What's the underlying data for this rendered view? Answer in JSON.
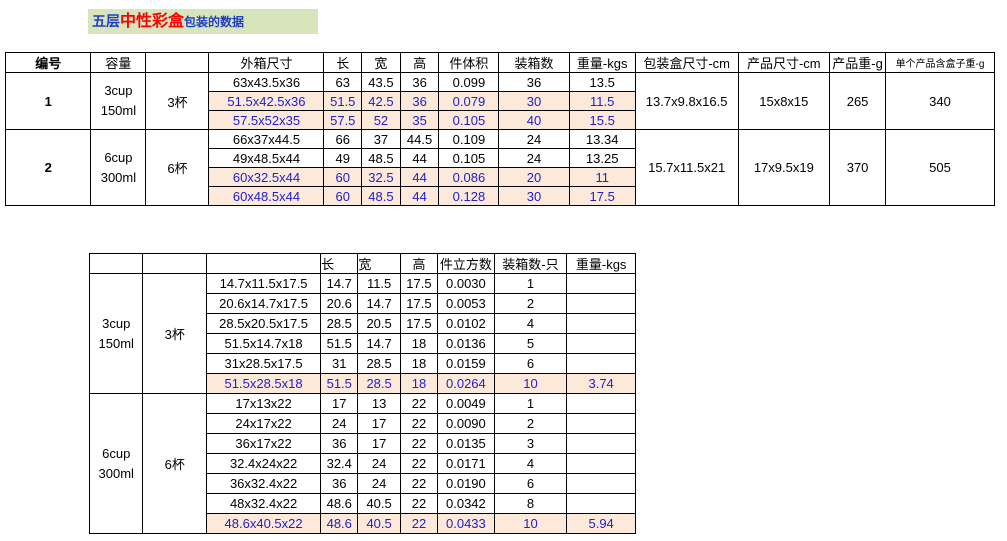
{
  "title": {
    "part1": "五层",
    "part2": "中性彩盒",
    "part3": "包装的数据"
  },
  "table1": {
    "headers": [
      "编号",
      "容量",
      "",
      "外箱尺寸",
      "长",
      "宽",
      "高",
      "件体积",
      "装箱数",
      "重量-kgs",
      "包装盒尺寸-cm",
      "产品尺寸-cm",
      "产品重-g",
      "单个产品含盒子重-g"
    ],
    "groups": [
      {
        "id": "1",
        "cap1": "3cup",
        "cap2": "150ml",
        "cup": "3杯",
        "box_size": "13.7x9.8x16.5",
        "product_size": "15x8x15",
        "product_weight": "265",
        "total_weight": "340",
        "rows": [
          {
            "size": "63x43.5x36",
            "l": "63",
            "w": "43.5",
            "h": "36",
            "vol": "0.099",
            "qty": "36",
            "kg": "13.5",
            "hl": false
          },
          {
            "size": "51.5x42.5x36",
            "l": "51.5",
            "w": "42.5",
            "h": "36",
            "vol": "0.079",
            "qty": "30",
            "kg": "11.5",
            "hl": true
          },
          {
            "size": "57.5x52x35",
            "l": "57.5",
            "w": "52",
            "h": "35",
            "vol": "0.105",
            "qty": "40",
            "kg": "15.5",
            "hl": true
          }
        ]
      },
      {
        "id": "2",
        "cap1": "6cup",
        "cap2": "300ml",
        "cup": "6杯",
        "box_size": "15.7x11.5x21",
        "product_size": "17x9.5x19",
        "product_weight": "370",
        "total_weight": "505",
        "rows": [
          {
            "size": "66x37x44.5",
            "l": "66",
            "w": "37",
            "h": "44.5",
            "vol": "0.109",
            "qty": "24",
            "kg": "13.34",
            "hl": false
          },
          {
            "size": "49x48.5x44",
            "l": "49",
            "w": "48.5",
            "h": "44",
            "vol": "0.105",
            "qty": "24",
            "kg": "13.25",
            "hl": false
          },
          {
            "size": "60x32.5x44",
            "l": "60",
            "w": "32.5",
            "h": "44",
            "vol": "0.086",
            "qty": "20",
            "kg": "11",
            "hl": true
          },
          {
            "size": "60x48.5x44",
            "l": "60",
            "w": "48.5",
            "h": "44",
            "vol": "0.128",
            "qty": "30",
            "kg": "17.5",
            "hl": true
          }
        ]
      }
    ]
  },
  "table2": {
    "headers": [
      "",
      "",
      "",
      "长",
      "宽",
      "高",
      "件立方数",
      "装箱数-只",
      "重量-kgs"
    ],
    "groups": [
      {
        "cap1": "3cup",
        "cap2": "150ml",
        "cup": "3杯",
        "rows": [
          {
            "size": "14.7x11.5x17.5",
            "l": "14.7",
            "w": "11.5",
            "h": "17.5",
            "vol": "0.0030",
            "qty": "1",
            "kg": "",
            "hl": false
          },
          {
            "size": "20.6x14.7x17.5",
            "l": "20.6",
            "w": "14.7",
            "h": "17.5",
            "vol": "0.0053",
            "qty": "2",
            "kg": "",
            "hl": false
          },
          {
            "size": "28.5x20.5x17.5",
            "l": "28.5",
            "w": "20.5",
            "h": "17.5",
            "vol": "0.0102",
            "qty": "4",
            "kg": "",
            "hl": false
          },
          {
            "size": "51.5x14.7x18",
            "l": "51.5",
            "w": "14.7",
            "h": "18",
            "vol": "0.0136",
            "qty": "5",
            "kg": "",
            "hl": false
          },
          {
            "size": "31x28.5x17.5",
            "l": "31",
            "w": "28.5",
            "h": "18",
            "vol": "0.0159",
            "qty": "6",
            "kg": "",
            "hl": false
          },
          {
            "size": "51.5x28.5x18",
            "l": "51.5",
            "w": "28.5",
            "h": "18",
            "vol": "0.0264",
            "qty": "10",
            "kg": "3.74",
            "hl": true
          }
        ]
      },
      {
        "cap1": "6cup",
        "cap2": "300ml",
        "cup": "6杯",
        "rows": [
          {
            "size": "17x13x22",
            "l": "17",
            "w": "13",
            "h": "22",
            "vol": "0.0049",
            "qty": "1",
            "kg": "",
            "hl": false
          },
          {
            "size": "24x17x22",
            "l": "24",
            "w": "17",
            "h": "22",
            "vol": "0.0090",
            "qty": "2",
            "kg": "",
            "hl": false
          },
          {
            "size": "36x17x22",
            "l": "36",
            "w": "17",
            "h": "22",
            "vol": "0.0135",
            "qty": "3",
            "kg": "",
            "hl": false
          },
          {
            "size": "32.4x24x22",
            "l": "32.4",
            "w": "24",
            "h": "22",
            "vol": "0.0171",
            "qty": "4",
            "kg": "",
            "hl": false
          },
          {
            "size": "36x32.4x22",
            "l": "36",
            "w": "24",
            "h": "22",
            "vol": "0.0190",
            "qty": "6",
            "kg": "",
            "hl": false
          },
          {
            "size": "48x32.4x22",
            "l": "48.6",
            "w": "40.5",
            "h": "22",
            "vol": "0.0342",
            "qty": "8",
            "kg": "",
            "hl": false
          },
          {
            "size": "48.6x40.5x22",
            "l": "48.6",
            "w": "40.5",
            "h": "22",
            "vol": "0.0433",
            "qty": "10",
            "kg": "5.94",
            "hl": true
          }
        ]
      }
    ]
  }
}
